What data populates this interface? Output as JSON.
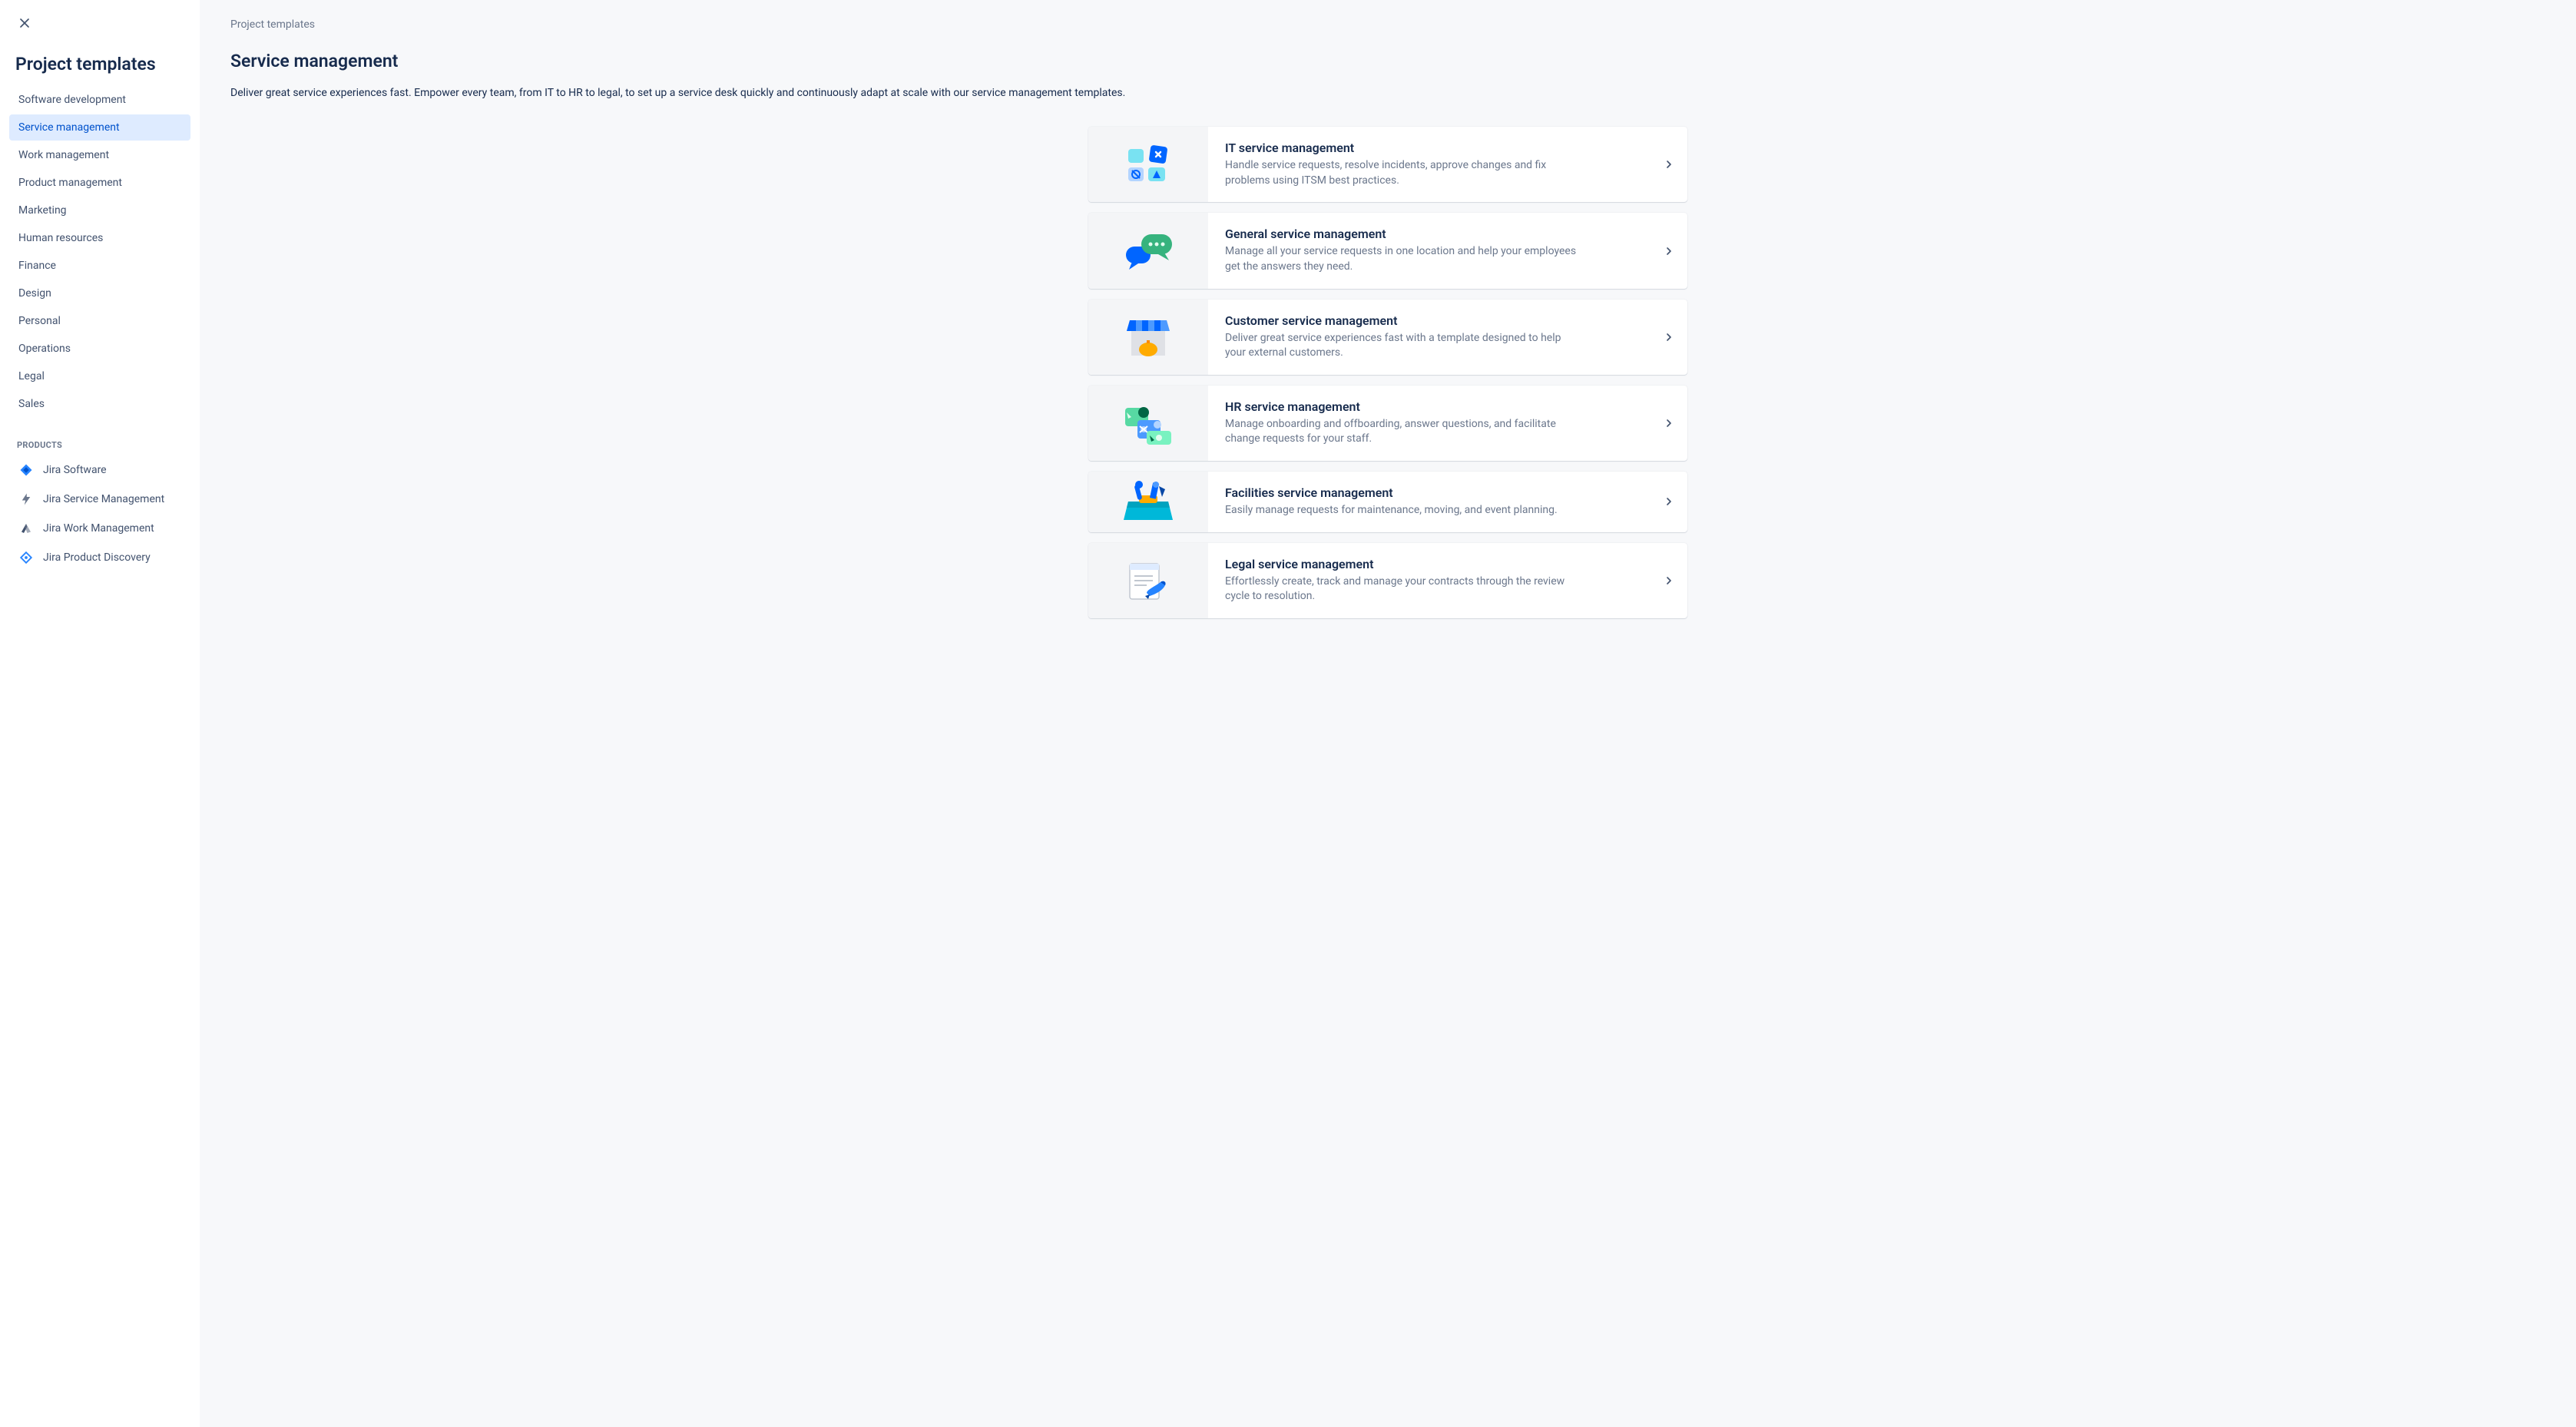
{
  "sidebar": {
    "heading": "Project templates",
    "categories": [
      {
        "label": "Software development"
      },
      {
        "label": "Service management"
      },
      {
        "label": "Work management"
      },
      {
        "label": "Product management"
      },
      {
        "label": "Marketing"
      },
      {
        "label": "Human resources"
      },
      {
        "label": "Finance"
      },
      {
        "label": "Design"
      },
      {
        "label": "Personal"
      },
      {
        "label": "Operations"
      },
      {
        "label": "Legal"
      },
      {
        "label": "Sales"
      }
    ],
    "active_index": 1,
    "products_label": "PRODUCTS",
    "products": [
      {
        "label": "Jira Software"
      },
      {
        "label": "Jira Service Management"
      },
      {
        "label": "Jira Work Management"
      },
      {
        "label": "Jira Product Discovery"
      }
    ]
  },
  "main": {
    "breadcrumb": "Project templates",
    "title": "Service management",
    "description": "Deliver great service experiences fast. Empower every team, from IT to HR to legal, to set up a service desk quickly and continuously adapt at scale with our service management templates.",
    "cards": [
      {
        "id": "it-service-management",
        "title": "IT service management",
        "desc": "Handle service requests, resolve incidents, approve changes and fix problems using ITSM best practices.",
        "icon": "itsm"
      },
      {
        "id": "general-service-management",
        "title": "General service management",
        "desc": "Manage all your service requests in one location and help your employees get the answers they need.",
        "icon": "chat"
      },
      {
        "id": "customer-service-management",
        "title": "Customer service management",
        "desc": "Deliver great service experiences fast with a template designed to help your external customers.",
        "icon": "storefront"
      },
      {
        "id": "hr-service-management",
        "title": "HR service management",
        "desc": "Manage onboarding and offboarding, answer questions, and facilitate change requests for your staff.",
        "icon": "people"
      },
      {
        "id": "facilities-service-management",
        "title": "Facilities service management",
        "desc": "Easily manage requests for maintenance, moving, and event planning.",
        "icon": "toolbox"
      },
      {
        "id": "legal-service-management",
        "title": "Legal service management",
        "desc": "Effortlessly create, track and manage your contracts through the review cycle to resolution.",
        "icon": "document"
      }
    ]
  }
}
